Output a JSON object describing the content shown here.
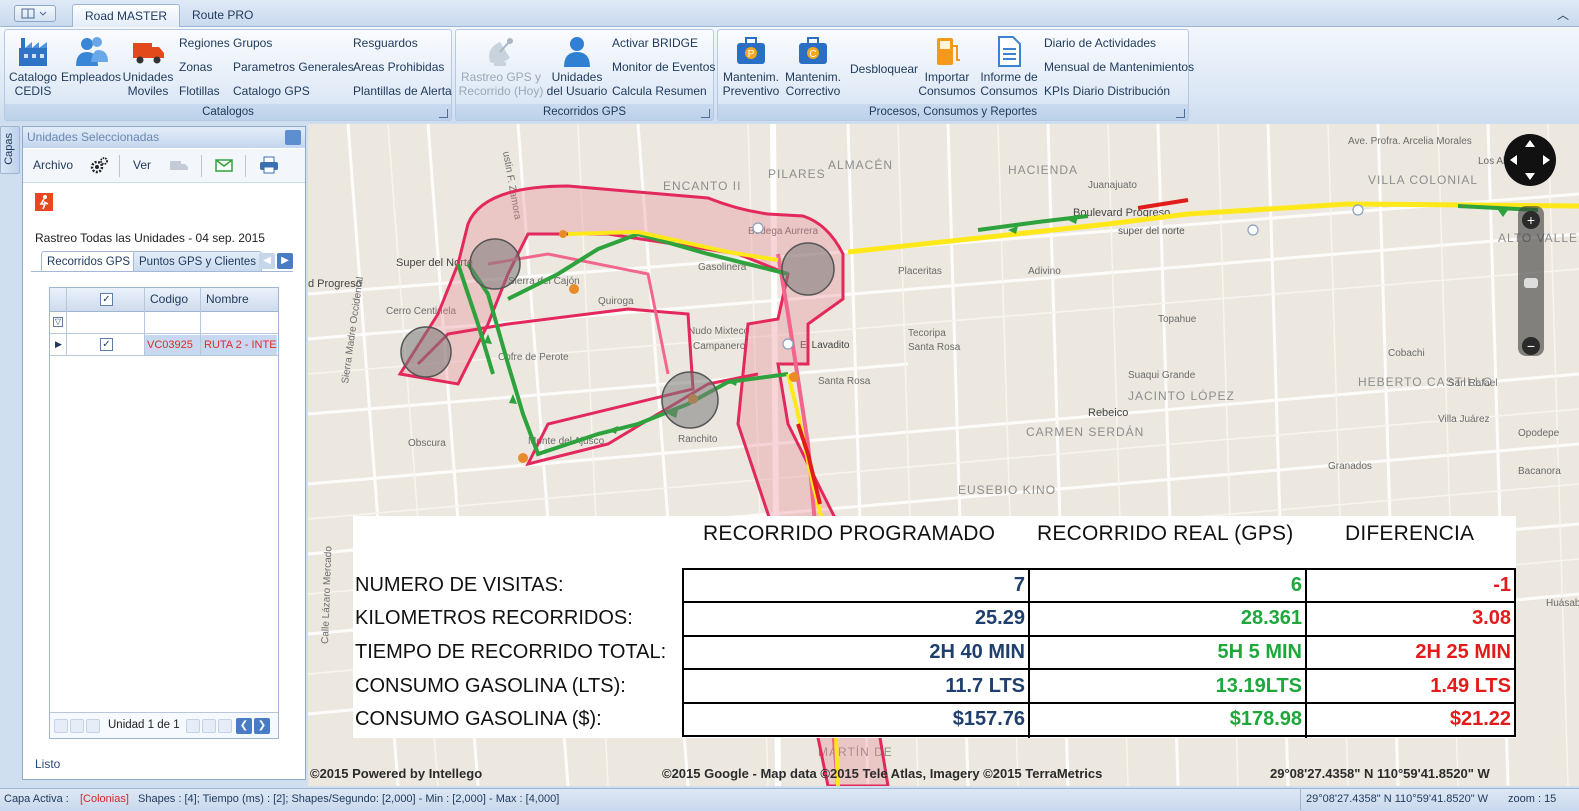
{
  "tabs": {
    "active": "Road MASTER",
    "other": "Route PRO"
  },
  "ribbon": {
    "catalogos": {
      "caption": "Catalogos",
      "catalogo_cedis": "Catalogo CEDIS",
      "empleados": "Empleados",
      "unidades_moviles": "Unidades Moviles",
      "regiones": "Regiones",
      "zonas": "Zonas",
      "flotillas": "Flotillas",
      "grupos": "Grupos",
      "parametros": "Parametros Generales",
      "catalogo_gps": "Catalogo GPS",
      "resguardos": "Resguardos",
      "areas_prohibidas": "Areas Prohibidas",
      "plantillas": "Plantillas de Alerta"
    },
    "recorridos": {
      "caption": "Recorridos GPS",
      "rastreo": "Rastreo GPS y Recorrido (Hoy)",
      "unidades_usuario": "Unidades del Usuario",
      "activar_bridge": "Activar BRIDGE",
      "monitor_eventos": "Monitor de Eventos",
      "calcula_resumen": "Calcula Resumen"
    },
    "procesos": {
      "caption": "Procesos, Consumos y Reportes",
      "mant_preventivo": "Mantenim. Preventivo",
      "mant_correctivo": "Mantenim. Correctivo",
      "desbloquear": "Desbloquear",
      "importar": "Importar Consumos",
      "informe": "Informe de Consumos",
      "diario": "Diario de Actividades",
      "mensual": "Mensual de Mantenimientos",
      "kpis": "KPIs Diario Distribución"
    }
  },
  "left": {
    "capas": "Capas",
    "panel_title": "Unidades Seleccionadas",
    "archivo": "Archivo",
    "ver": "Ver",
    "subtitle": "Rastreo Todas las Unidades - 04 sep. 2015",
    "tab_recorridos": "Recorridos GPS",
    "tab_puntos": "Puntos GPS y Clientes",
    "col_codigo": "Codigo",
    "col_nombre": "Nombre",
    "row": {
      "codigo": "VC03925",
      "nombre": "RUTA 2 - INTE"
    },
    "pager": "Unidad 1 de 1",
    "listo": "Listo"
  },
  "map": {
    "labels": [
      "ustin F. Zamora",
      "PILARES",
      "ALMACÉN",
      "ENCANTO II",
      "HACIENDA",
      "VILLA COLONIAL",
      "Bodega Aurrera",
      "Gasolinera",
      "Super del Norte",
      "d Progreso",
      "Boulevard Progreso",
      "super del norte",
      "Cerro Centinela",
      "Sierra del Cajón",
      "Quiroga",
      "Nudo Mixteco",
      "Campanero",
      "El Lavadito",
      "Placeritas",
      "Adivino",
      "Topahue",
      "Tecoripa",
      "Santa Rosa",
      "Santa Rosa",
      "Suaqui Grande",
      "Cobachi",
      "HEBERTO CASTILLO",
      "JACINTO LÓPEZ",
      "Rebeico",
      "CARMEN SERDÁN",
      "EUSEBIO KINO",
      "Granados",
      "Opodepe",
      "Bacanora",
      "Obscura",
      "Monte del Ajusco",
      "Ranchito",
      "Cofre de Perote",
      "Sierra Madre Occidental",
      "Calle Lázaro Mercado",
      "San Rafael",
      "Villa Juárez",
      "ALTO VALLE",
      "Los Alcaldes",
      "Juanajuato",
      "Ave. Profra. Arcelia Morales",
      "Huásabas",
      "MARTÍN DE"
    ],
    "copyright_left": "©2015 Powered by Intellego",
    "copyright_mid": "©2015 Google - Map data ©2015 Tele Atlas, Imagery ©2015 TerraMetrics",
    "coords": "29°08'27.4358\" N  110°59'41.8520\" W"
  },
  "report": {
    "headers": [
      "RECORRIDO PROGRAMADO",
      "RECORRIDO REAL (GPS)",
      "DIFERENCIA"
    ],
    "rows": [
      {
        "label": "NUMERO DE VISITAS:",
        "prog": "7",
        "real": "6",
        "diff": "-1"
      },
      {
        "label": "KILOMETROS RECORRIDOS:",
        "prog": "25.29",
        "real": "28.361",
        "diff": "3.08"
      },
      {
        "label": "TIEMPO DE RECORRIDO TOTAL:",
        "prog": "2H 40 MIN",
        "real": "5H 5 MIN",
        "diff": "2H 25 MIN"
      },
      {
        "label": "CONSUMO GASOLINA (LTS):",
        "prog": "11.7 LTS",
        "real": "13.19LTS",
        "diff": "1.49 LTS"
      },
      {
        "label": "CONSUMO GASOLINA ($):",
        "prog": "$157.76",
        "real": "$178.98",
        "diff": "$21.22"
      }
    ],
    "colors": {
      "prog": "#1f3f6e",
      "real": "#1ea83c",
      "diff": "#e31b1b"
    }
  },
  "status": {
    "capa_label": "Capa Activa :",
    "capa_value": "[Colonias]",
    "stats": "Shapes : [4]; Tiempo (ms) : [2]; Shapes/Segundo: [2,000] - Min : [2,000] - Max : [4,000]",
    "coords": "29°08'27.4358\" N 110°59'41.8520\" W",
    "zoom": "zoom : 15"
  }
}
